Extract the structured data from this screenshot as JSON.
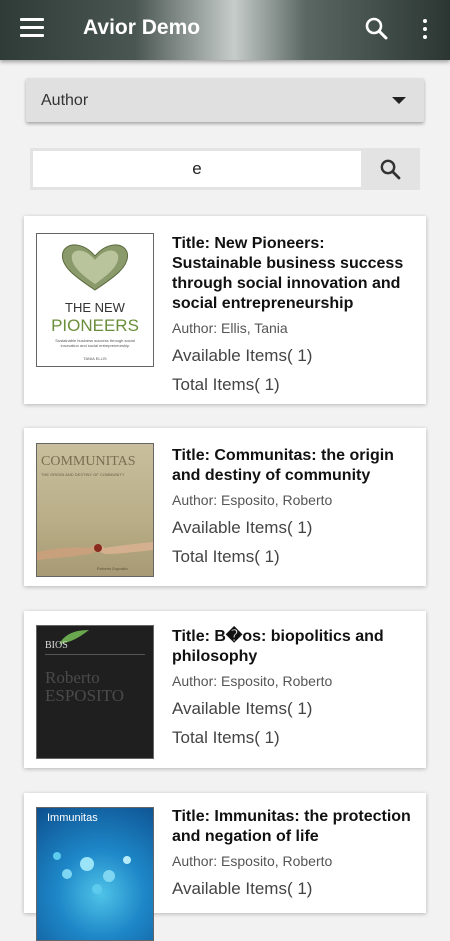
{
  "app": {
    "title": "Avior Demo"
  },
  "filter": {
    "selected": "Author"
  },
  "search": {
    "value": "e"
  },
  "books": [
    {
      "title": "Title: New Pioneers: Sustainable business success through social innovation and social entrepreneurship",
      "author": "Author: Ellis, Tania",
      "available": "Available Items( 1)",
      "total": "Total Items( 1)",
      "cover": {
        "line1": "THE NEW",
        "line2": "PIONEERS",
        "sub": "Sustainable business success through social innovation and social entrepreneurship",
        "byline": "TANIA ELLIS"
      }
    },
    {
      "title": "Title: Communitas: the origin and destiny of community",
      "author": "Author: Esposito, Roberto",
      "available": "Available Items( 1)",
      "total": "Total Items( 1)",
      "cover": {
        "line1": "COMMUNITAS",
        "sub": "THE ORIGIN AND DESTINY OF COMMUNITY",
        "byline": "Roberto Esposito"
      }
    },
    {
      "title": "Title: B�os: biopolitics and philosophy",
      "author": "Author: Esposito, Roberto",
      "available": "Available Items( 1)",
      "total": "Total Items( 1)",
      "cover": {
        "line1": "BIOS",
        "line2": "Roberto",
        "line3": "ESPOSITO"
      }
    },
    {
      "title": "Title: Immunitas: the protection and negation of life",
      "author": "Author: Esposito, Roberto",
      "available": "Available Items( 1)",
      "cover": {
        "line1": "Immunitas"
      }
    }
  ]
}
